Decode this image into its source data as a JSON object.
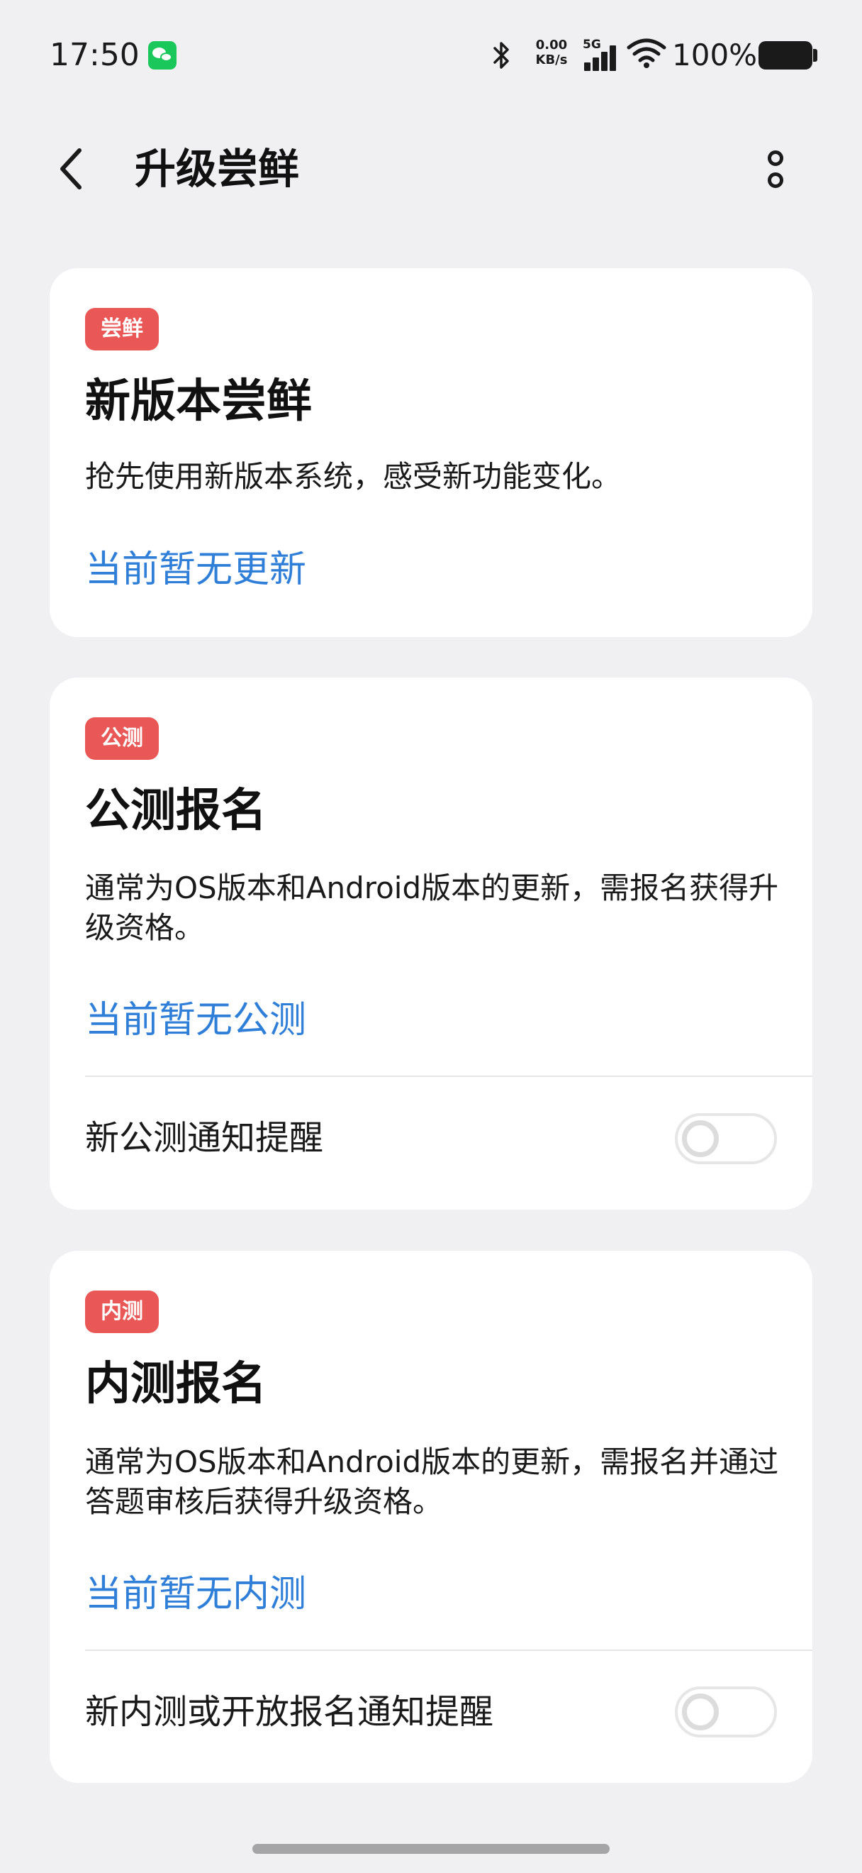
{
  "status_bar": {
    "time": "17:50",
    "net_speed_value": "0.00",
    "net_speed_unit": "KB/s",
    "network_type": "5G",
    "battery": "100%",
    "icons": [
      "wechat-icon",
      "bluetooth-icon",
      "signal-icon",
      "wifi-icon",
      "battery-icon"
    ]
  },
  "header": {
    "title": "升级尝鲜",
    "icons": [
      "back-arrow-icon",
      "more-options-icon"
    ]
  },
  "cards": [
    {
      "badge": "尝鲜",
      "title": "新版本尝鲜",
      "description": "抢先使用新版本系统，感受新功能变化。",
      "status": "当前暂无更新"
    },
    {
      "badge": "公测",
      "title": "公测报名",
      "description": "通常为OS版本和Android版本的更新，需报名获得升级资格。",
      "status": "当前暂无公测",
      "toggle_label": "新公测通知提醒",
      "toggle_on": false
    },
    {
      "badge": "内测",
      "title": "内测报名",
      "description": "通常为OS版本和Android版本的更新，需报名并通过答题审核后获得升级资格。",
      "status": "当前暂无内测",
      "toggle_label": "新内测或开放报名通知提醒",
      "toggle_on": false
    }
  ],
  "colors": {
    "background": "#f0f0f3",
    "card": "#ffffff",
    "badge": "#e95757",
    "status_link": "#2f7fd9",
    "text": "#111111"
  }
}
